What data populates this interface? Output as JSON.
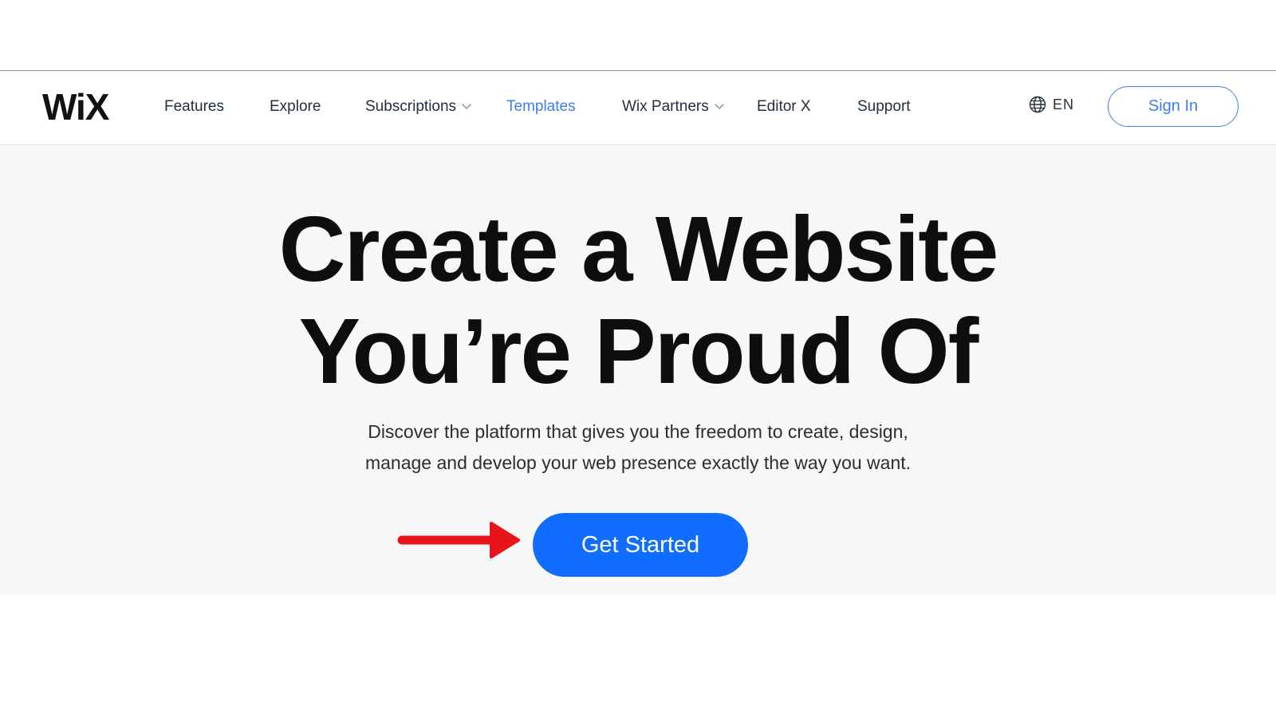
{
  "logo": {
    "text": "WiX"
  },
  "nav": {
    "items": [
      {
        "label": "Features"
      },
      {
        "label": "Explore"
      },
      {
        "label": "Subscriptions"
      },
      {
        "label": "Templates"
      },
      {
        "label": "Wix Partners"
      },
      {
        "label": "Editor X"
      },
      {
        "label": "Support"
      }
    ],
    "active_item": "Templates",
    "language": "EN",
    "language_icon": "globe-icon",
    "sign_in": "Sign In"
  },
  "hero": {
    "headline_line1": "Create a Website",
    "headline_line2": "You’re Proud Of",
    "sub_line1": "Discover the platform that gives you the freedom to create, design,",
    "sub_line2": "manage and develop your web presence exactly the way you want.",
    "cta": "Get Started",
    "annotation_icon": "red-arrow-icon"
  },
  "colors": {
    "accent": "#116dff",
    "link_active": "#3f7ee8",
    "arrow": "#e8141b"
  }
}
